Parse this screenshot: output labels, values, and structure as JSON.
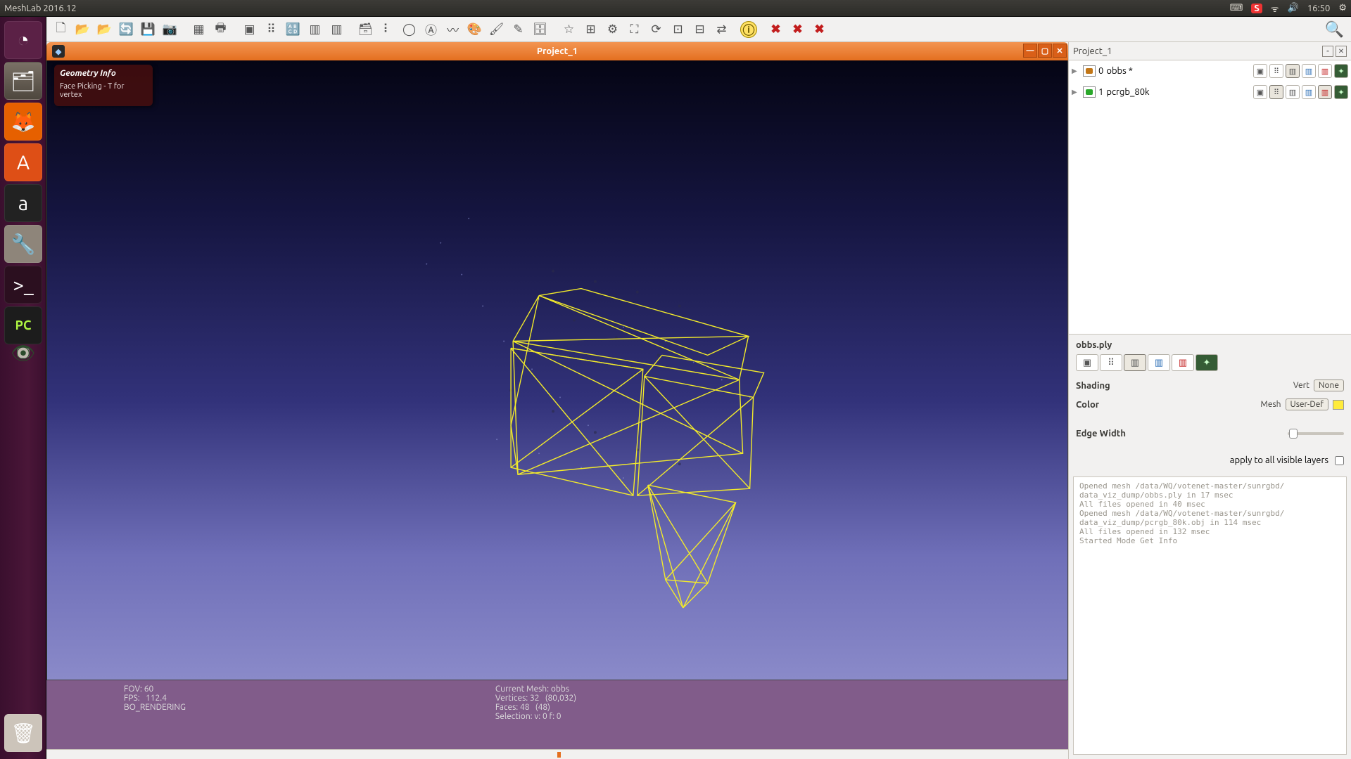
{
  "os": {
    "title": "MeshLab 2016.12",
    "tray": {
      "keyboard": "⌨",
      "s": "S",
      "wifi": "ᯤ",
      "sound": "🔊",
      "time": "16:50",
      "gear": "⚙"
    }
  },
  "launcher": {
    "items": [
      "◔",
      "🗂",
      "🦊",
      "A",
      "a",
      "🔧",
      ">_",
      "PC",
      "👁"
    ],
    "trash": "🗑"
  },
  "toolbar": {
    "groups": [
      [
        "🗋",
        "📂",
        "📂",
        "🔄",
        "💾",
        "📷"
      ],
      [
        "▦",
        "🖶"
      ],
      [
        "▣",
        "⠿",
        "🔠",
        "▥",
        "▥"
      ],
      [
        "🗃",
        "⠇",
        "◯",
        "Ⓐ",
        "〰",
        "🎨",
        "🖌",
        "✎",
        "🗄"
      ],
      [
        "☆",
        "⊞",
        "⚙",
        "⛶",
        "⟳",
        "⊡",
        "⊟",
        "⇄"
      ],
      [
        "ⓘ"
      ],
      [
        "✖",
        "✖",
        "✖"
      ]
    ],
    "searchIcon": "🔍"
  },
  "viewer": {
    "projectTitle": "Project_1",
    "geomInfo": {
      "title": "Geometry Info",
      "body": "Face Picking - T for vertex"
    }
  },
  "status": {
    "left": "FOV: 60\nFPS:   112.4\nBO_RENDERING",
    "right": "Current Mesh: obbs\nVertices: 32   (80,032)\nFaces: 48   (48)\nSelection: v: 0 f: 0"
  },
  "rightPanel": {
    "title": "Project_1",
    "layers": [
      {
        "eye": "off",
        "idx": "0",
        "name": "obbs *"
      },
      {
        "eye": "on",
        "idx": "1",
        "name": "pcrgb_80k"
      }
    ],
    "shading": {
      "file": "obbs.ply",
      "shadingLabel": "Shading",
      "shadingSide": "Vert",
      "shadingVal": "None",
      "colorLabel": "Color",
      "colorSide": "Mesh",
      "colorVal": "User-Def",
      "edgeLabel": "Edge Width"
    },
    "applyLabel": "apply to all visible layers"
  },
  "log": "Opened mesh /data/WQ/votenet-master/sunrgbd/\ndata_viz_dump/obbs.ply in 17 msec\nAll files opened in 40 msec\nOpened mesh /data/WQ/votenet-master/sunrgbd/\ndata_viz_dump/pcrgb_80k.obj in 114 msec\nAll files opened in 132 msec\nStarted Mode Get Info"
}
